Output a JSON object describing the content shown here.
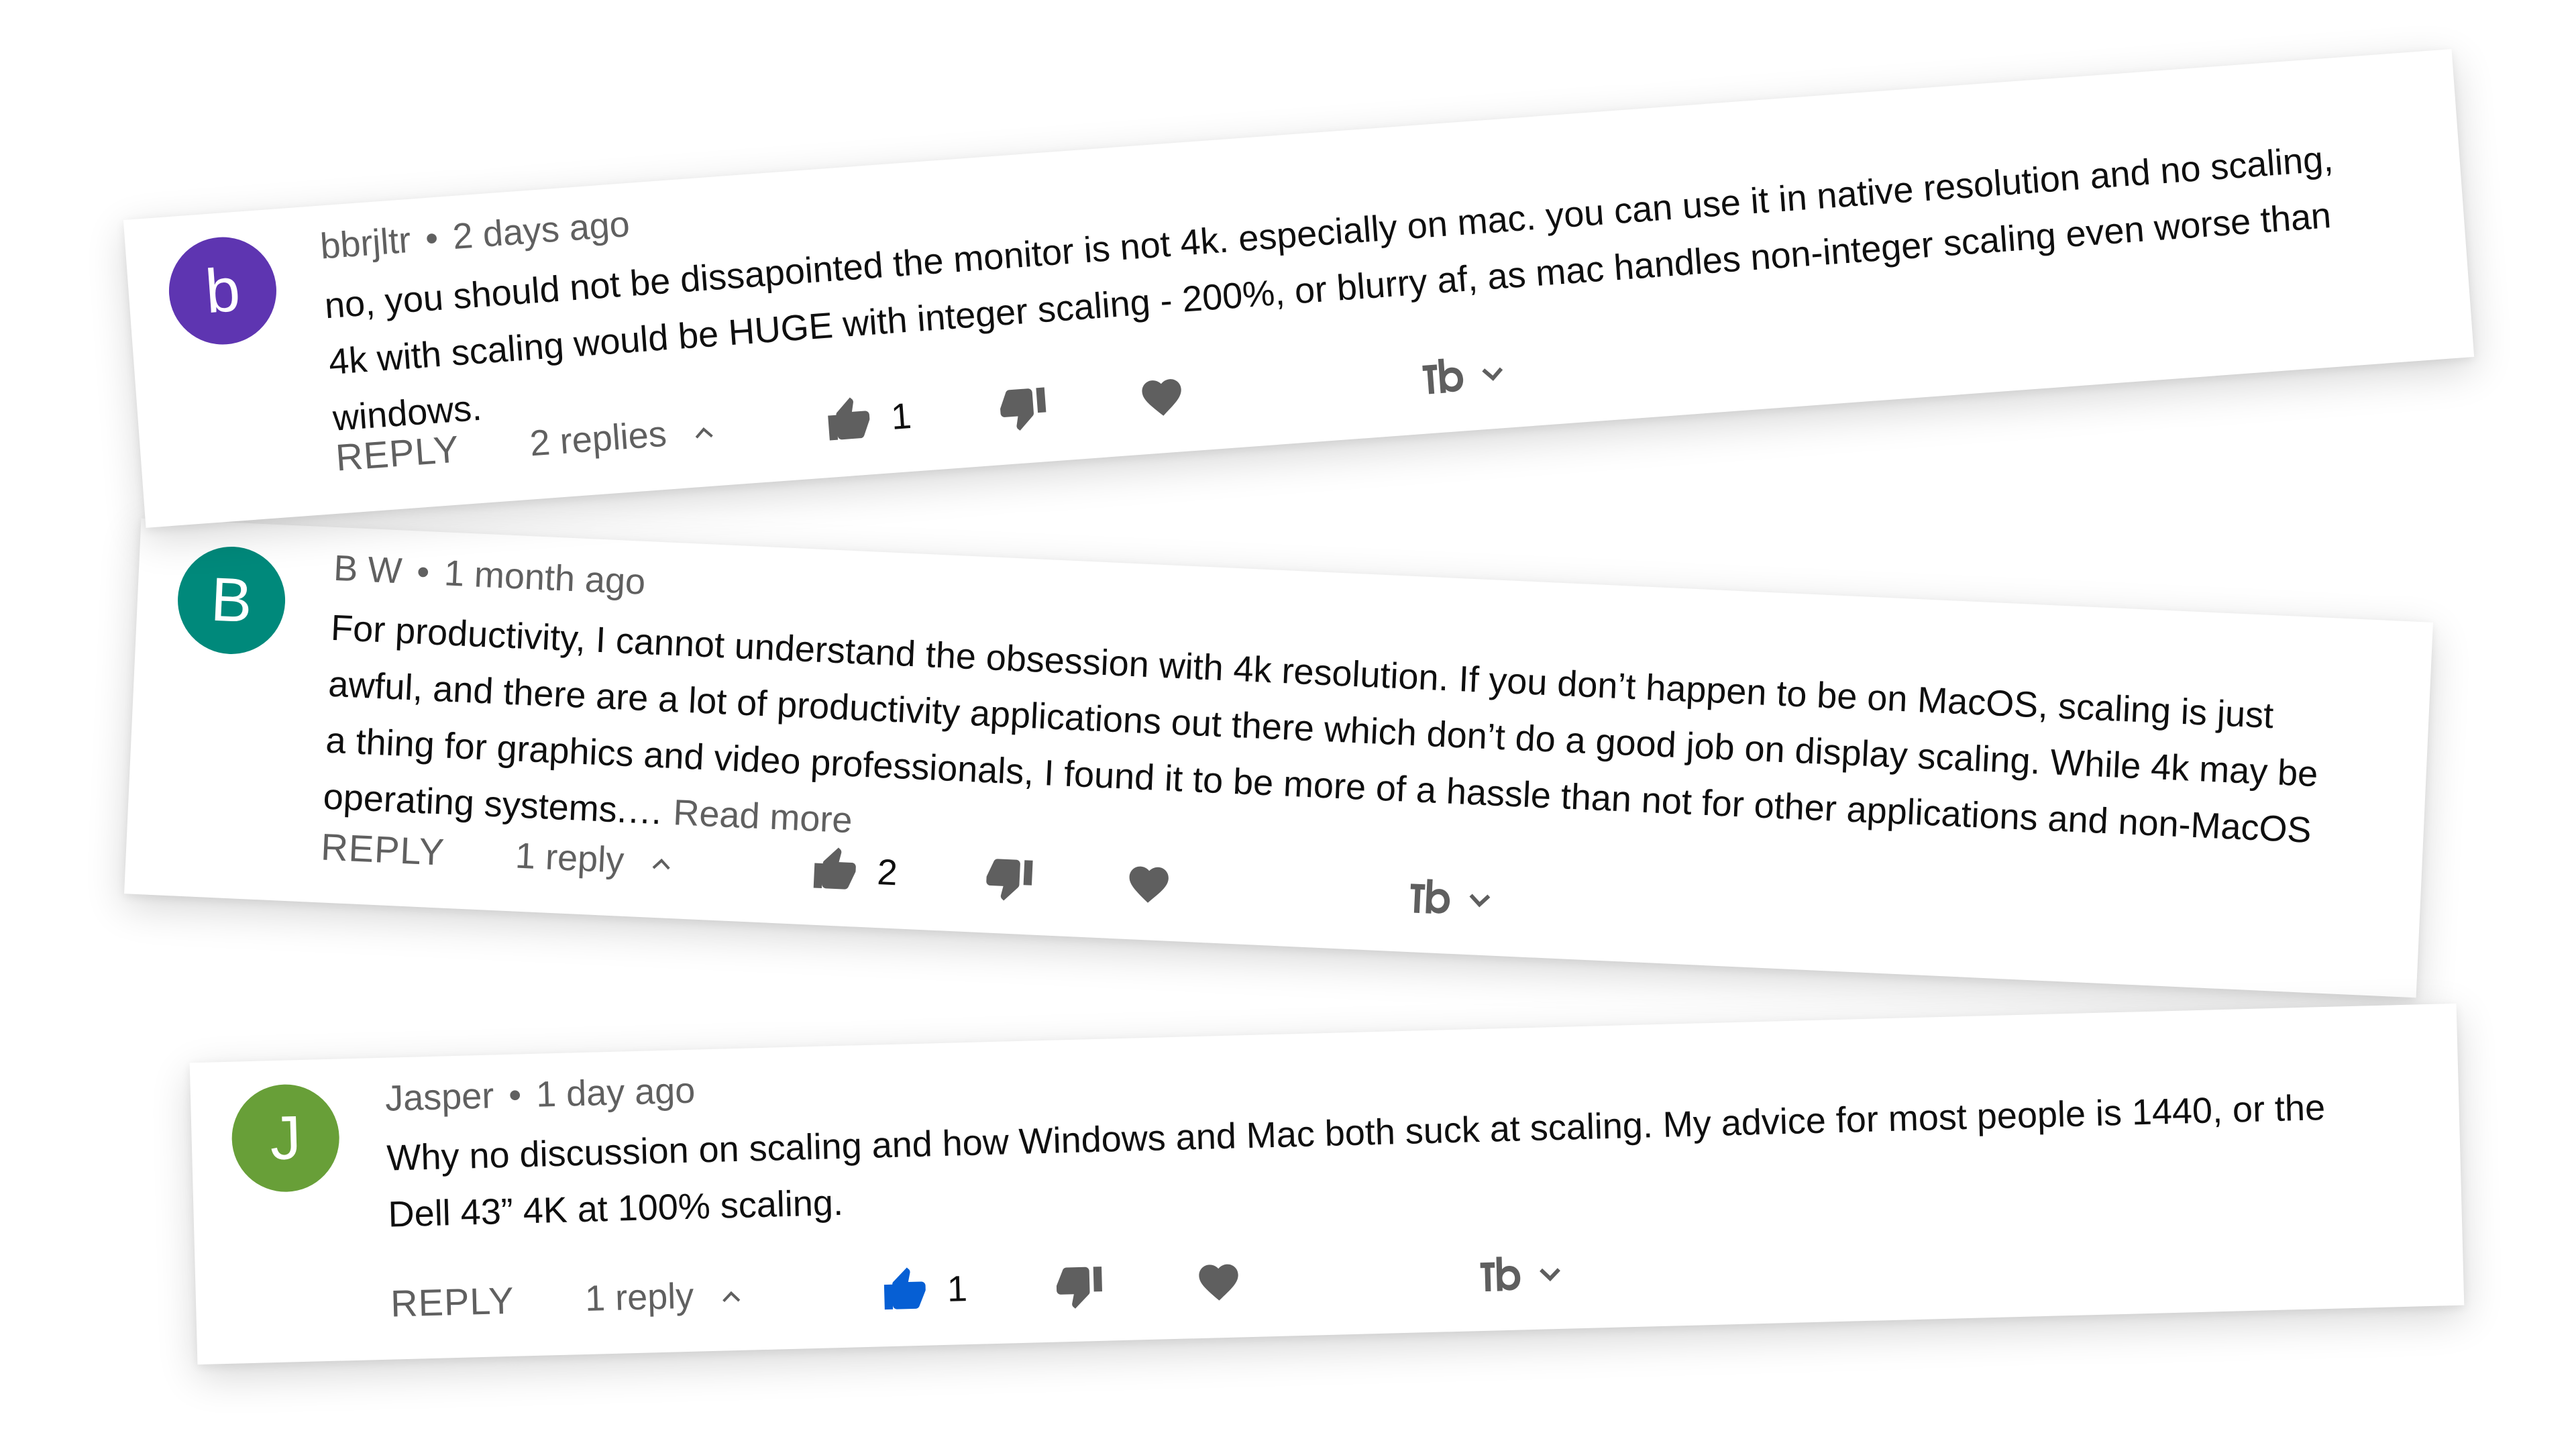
{
  "colors": {
    "thumb_active": "#065fd4",
    "icon_gray": "#5f5f5f"
  },
  "comments": [
    {
      "avatar_letter": "b",
      "avatar_color": "#5e35b1",
      "author": "bbrjltr",
      "separator": "•",
      "time": "2 days ago",
      "text": "no, you should not be dissapointed the monitor is not 4k. especially on mac. you can use it in native resolution and no scaling, 4k with scaling would be HUGE with integer scaling - 200%, or blurry af, as mac handles non-integer scaling even worse than windows.",
      "read_more": "",
      "reply_label": "REPLY",
      "replies_label": "2 replies",
      "like_count": "1",
      "like_active": false,
      "like_icon": "thumb-up-icon",
      "dislike_icon": "thumb-down-icon",
      "heart_icon": "heart-icon",
      "extension_icon": "tb-extension-icon"
    },
    {
      "avatar_letter": "B",
      "avatar_color": "#00897b",
      "author": "B W",
      "separator": "•",
      "time": "1 month ago",
      "text": "For productivity, I cannot understand the obsession with 4k resolution. If you don’t happen to be on MacOS, scaling is just awful, and there are a lot of productivity applications out there which don’t do a good job on display scaling. While 4k may be a thing for graphics and video professionals, I found it to be more of a hassle than not for other applications and non-MacOS operating systems.…",
      "read_more": "Read more",
      "reply_label": "REPLY",
      "replies_label": "1 reply",
      "like_count": "2",
      "like_active": false,
      "like_icon": "thumb-up-icon",
      "dislike_icon": "thumb-down-icon",
      "heart_icon": "heart-icon",
      "extension_icon": "tb-extension-icon"
    },
    {
      "avatar_letter": "J",
      "avatar_color": "#689f38",
      "author": "Jasper",
      "separator": "•",
      "time": "1 day ago",
      "text": "Why no discussion on scaling and how Windows and Mac both suck at scaling.  My advice for most people is 1440, or the Dell 43” 4K at 100% scaling.",
      "read_more": "",
      "reply_label": "REPLY",
      "replies_label": "1 reply",
      "like_count": "1",
      "like_active": true,
      "like_icon": "thumb-up-icon",
      "dislike_icon": "thumb-down-icon",
      "heart_icon": "heart-icon",
      "extension_icon": "tb-extension-icon"
    }
  ]
}
